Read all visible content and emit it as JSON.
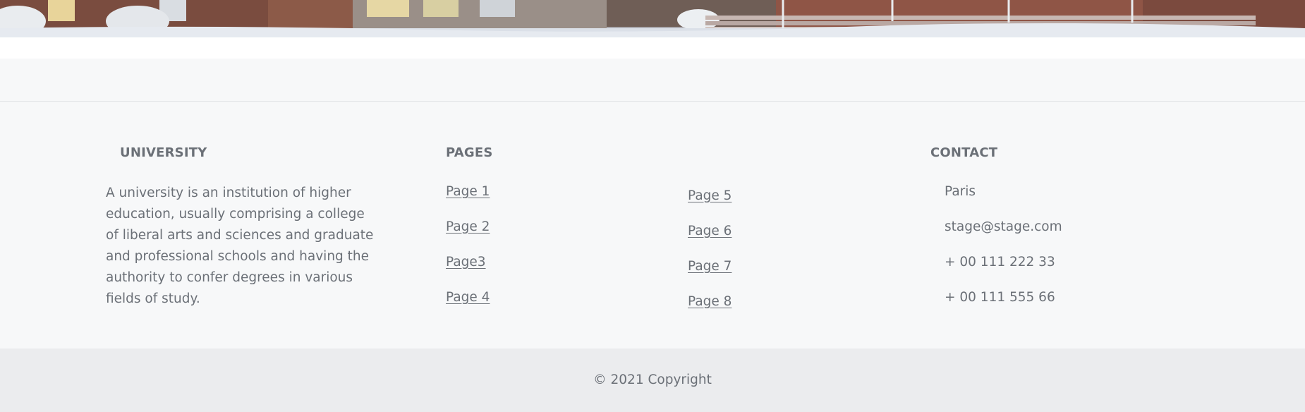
{
  "about": {
    "heading": "UNIVERSITY",
    "text": "A university is an institution of higher education, usually comprising a college of liberal arts and sciences and graduate and professional schools and having the authority to confer degrees in various fields of study."
  },
  "pages": {
    "heading": "PAGES",
    "links": [
      "Page 1",
      "Page 2",
      "Page3",
      "Page 4",
      "Page 5",
      "Page 6",
      "Page 7",
      "Page 8"
    ]
  },
  "contact": {
    "heading": "CONTACT",
    "items": [
      "Paris",
      "stage@stage.com",
      "+ 00 111 222 33",
      "+ 00 111 555 66"
    ]
  },
  "copyright": "© 2021 Copyright",
  "colors": {
    "footer_bg": "#f7f8f9",
    "copyright_bg": "#ebecee",
    "text": "#6b7077"
  }
}
